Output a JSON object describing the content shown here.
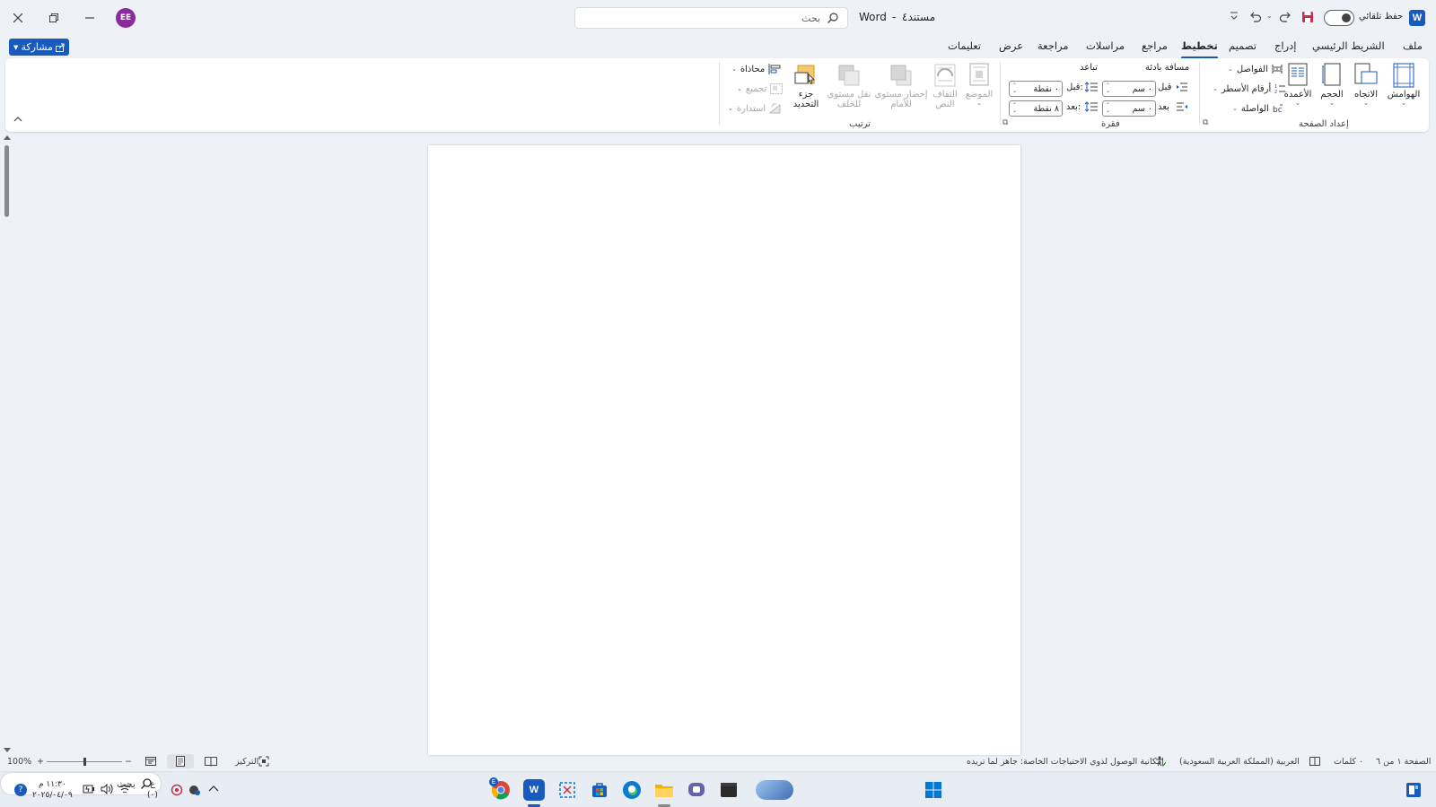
{
  "titlebar": {
    "app_name": "Word",
    "separator": "-",
    "doc_name": "مستند٤",
    "search_placeholder": "بحث",
    "autosave_label": "حفظ تلقائي",
    "user_initials": "EE",
    "app_logo": "W"
  },
  "menu": {
    "tabs": [
      "ملف",
      "الشريط الرئيسي",
      "إدراج",
      "تصميم",
      "تخطيط",
      "مراجع",
      "مراسلات",
      "مراجعة",
      "عرض",
      "تعليمات"
    ],
    "active_tab": "تخطيط",
    "share_label": "مشاركة"
  },
  "ribbon": {
    "page_setup": {
      "label": "إعداد الصفحة",
      "margins": "الهوامش",
      "orientation": "الاتجاه",
      "size": "الحجم",
      "columns": "الأعمدة",
      "breaks": "الفواصل",
      "line_numbers": "أرقام الأسطر",
      "hyphenation": "الواصلة"
    },
    "paragraph": {
      "label": "فقرة",
      "indent_label": "مسافة بادئة",
      "spacing_label": "تباعد",
      "indent_before_label": "قبل",
      "indent_after_label": "بعد",
      "indent_before_value": "٠ سم",
      "indent_after_value": "٠ سم",
      "spacing_before_label": "قبل:",
      "spacing_after_label": "بعد:",
      "spacing_before_value": "٠ نقطة",
      "spacing_after_value": "٨ نقطة"
    },
    "arrange": {
      "label": "ترتيب",
      "position": "الموضع",
      "wrap_text_1": "التفاف",
      "wrap_text_2": "النص",
      "bring_forward_1": "إحضار مستوى",
      "bring_forward_2": "للأمام",
      "send_backward_1": "نقل مستوى",
      "send_backward_2": "للخلف",
      "selection_pane_1": "جزء",
      "selection_pane_2": "التحديد",
      "align": "محاذاة",
      "group": "تجميع",
      "rotate": "استدارة"
    }
  },
  "statusbar": {
    "page_info": "الصفحة ١ من ٦",
    "words": "٠ كلمات",
    "language": "العربية (المملكة العربية السعودية)",
    "accessibility": "إمكانية الوصول لذوي الاحتياجات الخاصة: جاهز لما تريده",
    "focus": "التركيز",
    "zoom": "100%",
    "zoom_fraction": 0.5
  },
  "taskbar": {
    "search_placeholder": "بحث",
    "time": "١١:٣٠ م",
    "date": "٢٠٢٥/٠٤/٠٩",
    "lang_top": "ع",
    "lang_bottom": "(٠)",
    "chrome_badge": "E"
  },
  "colors": {
    "accent": "#185abd",
    "avatar": "#8a2c9d",
    "background": "#eef2f6"
  }
}
